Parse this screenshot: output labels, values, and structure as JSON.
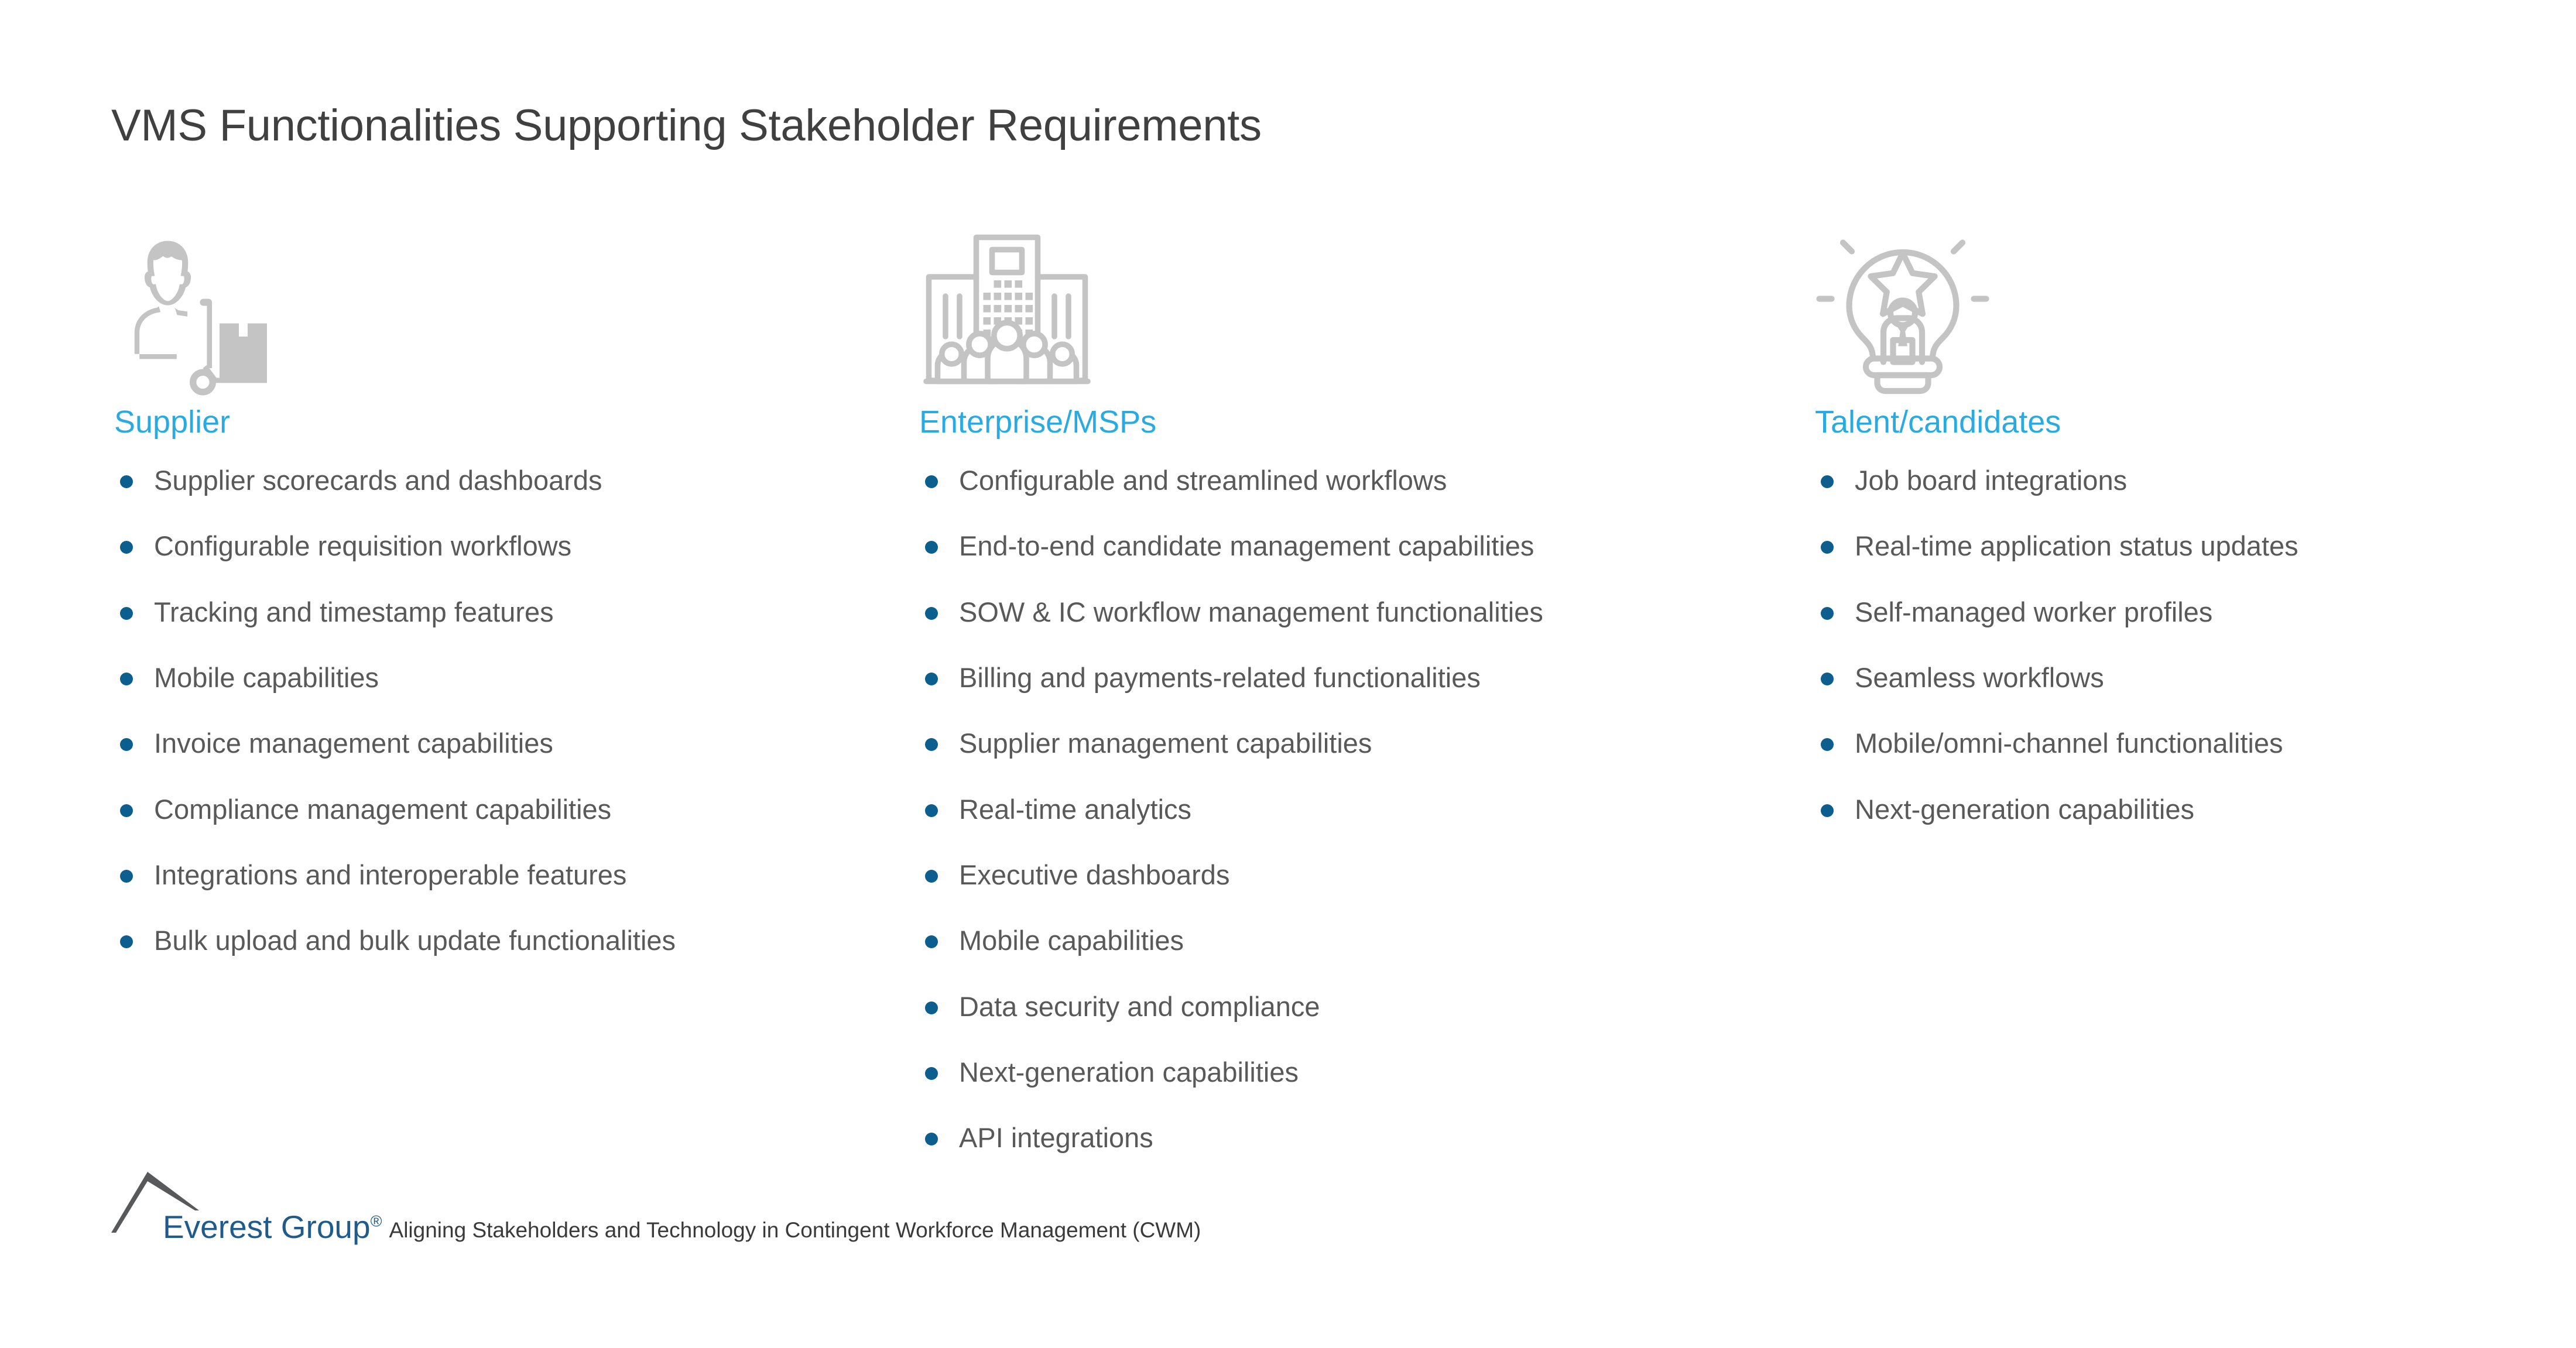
{
  "slide": {
    "title": "VMS Functionalities Supporting Stakeholder Requirements",
    "accent_heading_color": "#29ABE2",
    "bullet_color": "#0B5E8E",
    "body_text_color": "#595959",
    "title_color": "#404040",
    "icon_color": "#C4C4C4",
    "background_color": "#FFFFFF"
  },
  "columns": [
    {
      "icon": "supplier-person-hand-truck-icon",
      "heading": "Supplier",
      "bullets": [
        "Supplier scorecards and dashboards",
        "Configurable requisition workflows",
        "Tracking and timestamp features",
        "Mobile capabilities",
        "Invoice management capabilities",
        "Compliance management capabilities",
        "Integrations and interoperable features",
        "Bulk upload and bulk update functionalities"
      ]
    },
    {
      "icon": "enterprise-building-people-icon",
      "heading": "Enterprise/MSPs",
      "bullets": [
        "Configurable and streamlined workflows",
        "End-to-end candidate management capabilities",
        "SOW & IC workflow management functionalities",
        "Billing and payments-related functionalities",
        "Supplier management capabilities",
        "Real-time analytics",
        "Executive dashboards",
        "Mobile capabilities",
        "Data security and compliance",
        "Next-generation capabilities",
        "API integrations"
      ]
    },
    {
      "icon": "talent-lightbulb-star-person-icon",
      "heading": "Talent/candidates",
      "bullets": [
        "Job board integrations",
        "Real-time application status updates",
        "Self-managed worker profiles",
        "Seamless workflows",
        "Mobile/omni-channel functionalities",
        "Next-generation capabilities"
      ]
    }
  ],
  "footer": {
    "logo_icon": "everest-group-mountain-peak-logo",
    "logo_text": "Everest Group",
    "logo_registered_mark": "®",
    "caption": "Aligning Stakeholders and Technology in Contingent Workforce Management (CWM)",
    "logo_text_color": "#1F5C8B",
    "logo_mark_color": "#58595B"
  }
}
